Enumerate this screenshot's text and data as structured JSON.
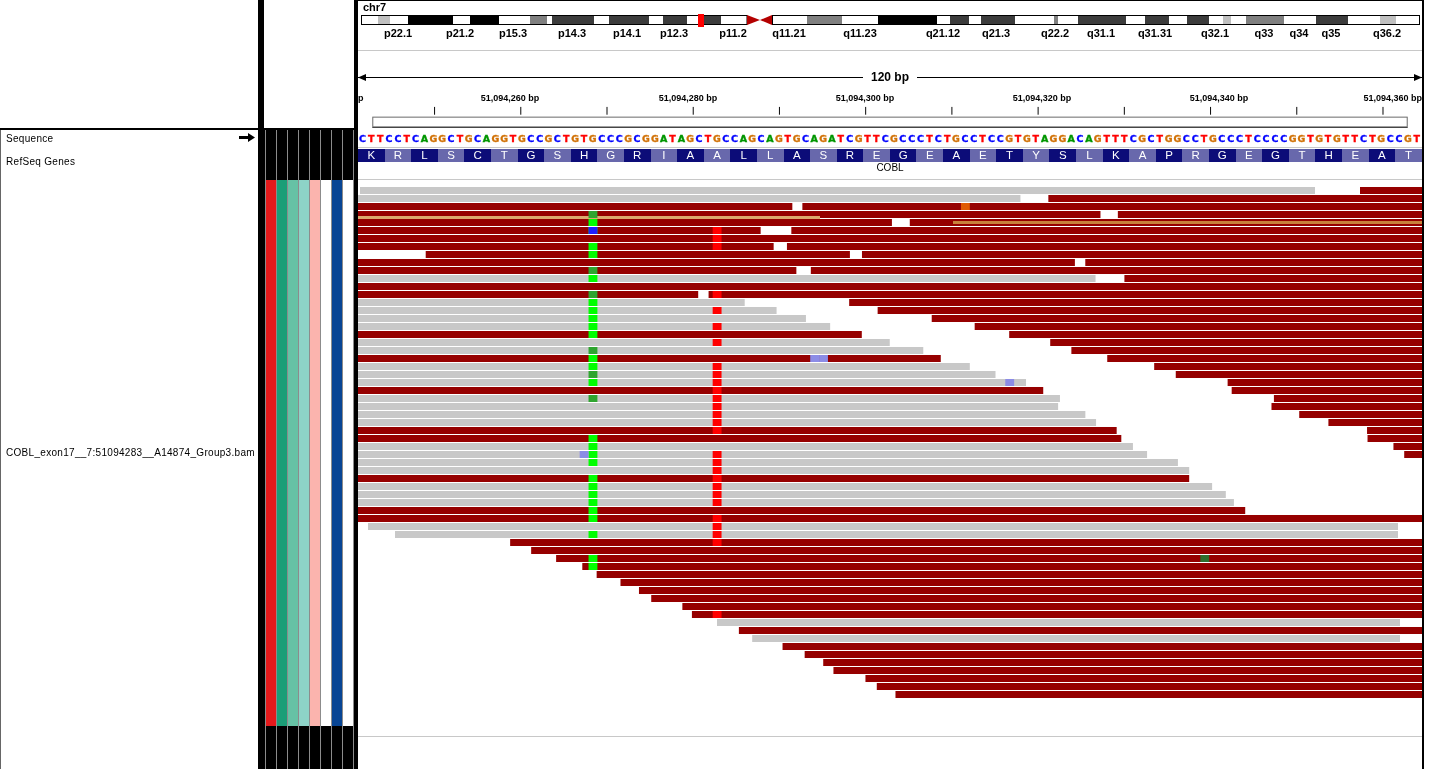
{
  "ideogram": {
    "chromosome": "chr7",
    "band_labels": [
      "p22.1",
      "p21.2",
      "p15.3",
      "p14.3",
      "p14.1",
      "p12.3",
      "p11.2",
      "q11.21",
      "q11.23",
      "q21.12",
      "q21.3",
      "q22.2",
      "q31.1",
      "q31.31",
      "q32.1",
      "q33",
      "q34",
      "q35",
      "q36.2"
    ]
  },
  "ruler": {
    "span": "120 bp",
    "tick_labels": [
      "p",
      "51,094,260 bp",
      "51,094,280 bp",
      "51,094,300 bp",
      "51,094,320 bp",
      "51,094,340 bp",
      "51,094,360 bp"
    ]
  },
  "tracks": [
    {
      "kind": "sequence",
      "name": "Sequence",
      "bases": [
        {
          "base": "C",
          "color": "#0000ff"
        },
        {
          "base": "T",
          "color": "#ff0000"
        },
        {
          "base": "T",
          "color": "#ff0000"
        },
        {
          "base": "C",
          "color": "#0000ff"
        },
        {
          "base": "C",
          "color": "#0000ff"
        },
        {
          "base": "T",
          "color": "#ff0000"
        },
        {
          "base": "C",
          "color": "#0000ff"
        },
        {
          "base": "A",
          "color": "#009600"
        },
        {
          "base": "G",
          "color": "#d17105"
        },
        {
          "base": "G",
          "color": "#d17105"
        },
        {
          "base": "C",
          "color": "#0000ff"
        },
        {
          "base": "T",
          "color": "#ff0000"
        },
        {
          "base": "G",
          "color": "#d17105"
        },
        {
          "base": "C",
          "color": "#0000ff"
        },
        {
          "base": "A",
          "color": "#009600"
        },
        {
          "base": "G",
          "color": "#d17105"
        },
        {
          "base": "G",
          "color": "#d17105"
        },
        {
          "base": "T",
          "color": "#ff0000"
        },
        {
          "base": "G",
          "color": "#d17105"
        },
        {
          "base": "C",
          "color": "#0000ff"
        },
        {
          "base": "C",
          "color": "#0000ff"
        },
        {
          "base": "G",
          "color": "#d17105"
        },
        {
          "base": "C",
          "color": "#0000ff"
        },
        {
          "base": "T",
          "color": "#ff0000"
        },
        {
          "base": "G",
          "color": "#d17105"
        },
        {
          "base": "T",
          "color": "#ff0000"
        },
        {
          "base": "G",
          "color": "#d17105"
        },
        {
          "base": "C",
          "color": "#0000ff"
        },
        {
          "base": "C",
          "color": "#0000ff"
        },
        {
          "base": "C",
          "color": "#0000ff"
        },
        {
          "base": "G",
          "color": "#d17105"
        },
        {
          "base": "C",
          "color": "#0000ff"
        },
        {
          "base": "G",
          "color": "#d17105"
        },
        {
          "base": "G",
          "color": "#d17105"
        },
        {
          "base": "A",
          "color": "#009600"
        },
        {
          "base": "T",
          "color": "#ff0000"
        },
        {
          "base": "A",
          "color": "#009600"
        },
        {
          "base": "G",
          "color": "#d17105"
        },
        {
          "base": "C",
          "color": "#0000ff"
        },
        {
          "base": "T",
          "color": "#ff0000"
        },
        {
          "base": "G",
          "color": "#d17105"
        },
        {
          "base": "C",
          "color": "#0000ff"
        },
        {
          "base": "C",
          "color": "#0000ff"
        },
        {
          "base": "A",
          "color": "#009600"
        },
        {
          "base": "G",
          "color": "#d17105"
        },
        {
          "base": "C",
          "color": "#0000ff"
        },
        {
          "base": "A",
          "color": "#009600"
        },
        {
          "base": "G",
          "color": "#d17105"
        },
        {
          "base": "T",
          "color": "#ff0000"
        },
        {
          "base": "G",
          "color": "#d17105"
        },
        {
          "base": "C",
          "color": "#0000ff"
        },
        {
          "base": "A",
          "color": "#009600"
        },
        {
          "base": "G",
          "color": "#d17105"
        },
        {
          "base": "A",
          "color": "#009600"
        },
        {
          "base": "T",
          "color": "#ff0000"
        },
        {
          "base": "C",
          "color": "#0000ff"
        },
        {
          "base": "G",
          "color": "#d17105"
        },
        {
          "base": "T",
          "color": "#ff0000"
        },
        {
          "base": "T",
          "color": "#ff0000"
        },
        {
          "base": "C",
          "color": "#0000ff"
        },
        {
          "base": "G",
          "color": "#d17105"
        },
        {
          "base": "C",
          "color": "#0000ff"
        },
        {
          "base": "C",
          "color": "#0000ff"
        },
        {
          "base": "C",
          "color": "#0000ff"
        },
        {
          "base": "T",
          "color": "#ff0000"
        },
        {
          "base": "C",
          "color": "#0000ff"
        },
        {
          "base": "T",
          "color": "#ff0000"
        },
        {
          "base": "G",
          "color": "#d17105"
        },
        {
          "base": "C",
          "color": "#0000ff"
        },
        {
          "base": "C",
          "color": "#0000ff"
        },
        {
          "base": "T",
          "color": "#ff0000"
        },
        {
          "base": "C",
          "color": "#0000ff"
        },
        {
          "base": "C",
          "color": "#0000ff"
        },
        {
          "base": "G",
          "color": "#d17105"
        },
        {
          "base": "T",
          "color": "#ff0000"
        },
        {
          "base": "G",
          "color": "#d17105"
        },
        {
          "base": "T",
          "color": "#ff0000"
        },
        {
          "base": "A",
          "color": "#009600"
        },
        {
          "base": "G",
          "color": "#d17105"
        },
        {
          "base": "G",
          "color": "#d17105"
        },
        {
          "base": "A",
          "color": "#009600"
        },
        {
          "base": "C",
          "color": "#0000ff"
        },
        {
          "base": "A",
          "color": "#009600"
        },
        {
          "base": "G",
          "color": "#d17105"
        },
        {
          "base": "T",
          "color": "#ff0000"
        },
        {
          "base": "T",
          "color": "#ff0000"
        },
        {
          "base": "T",
          "color": "#ff0000"
        },
        {
          "base": "C",
          "color": "#0000ff"
        },
        {
          "base": "G",
          "color": "#d17105"
        },
        {
          "base": "C",
          "color": "#0000ff"
        },
        {
          "base": "T",
          "color": "#ff0000"
        },
        {
          "base": "G",
          "color": "#d17105"
        },
        {
          "base": "G",
          "color": "#d17105"
        },
        {
          "base": "C",
          "color": "#0000ff"
        },
        {
          "base": "C",
          "color": "#0000ff"
        },
        {
          "base": "T",
          "color": "#ff0000"
        },
        {
          "base": "G",
          "color": "#d17105"
        },
        {
          "base": "C",
          "color": "#0000ff"
        },
        {
          "base": "C",
          "color": "#0000ff"
        },
        {
          "base": "C",
          "color": "#0000ff"
        },
        {
          "base": "T",
          "color": "#ff0000"
        },
        {
          "base": "C",
          "color": "#0000ff"
        },
        {
          "base": "C",
          "color": "#0000ff"
        },
        {
          "base": "C",
          "color": "#0000ff"
        },
        {
          "base": "C",
          "color": "#0000ff"
        },
        {
          "base": "G",
          "color": "#d17105"
        },
        {
          "base": "G",
          "color": "#d17105"
        },
        {
          "base": "T",
          "color": "#ff0000"
        },
        {
          "base": "G",
          "color": "#d17105"
        },
        {
          "base": "T",
          "color": "#ff0000"
        },
        {
          "base": "G",
          "color": "#d17105"
        },
        {
          "base": "T",
          "color": "#ff0000"
        },
        {
          "base": "T",
          "color": "#ff0000"
        },
        {
          "base": "C",
          "color": "#0000ff"
        },
        {
          "base": "T",
          "color": "#ff0000"
        },
        {
          "base": "G",
          "color": "#d17105"
        },
        {
          "base": "C",
          "color": "#0000ff"
        },
        {
          "base": "C",
          "color": "#0000ff"
        },
        {
          "base": "G",
          "color": "#d17105"
        },
        {
          "base": "T",
          "color": "#ff0000"
        }
      ]
    },
    {
      "kind": "gene",
      "name": "RefSeq Genes",
      "gene": "COBL",
      "amino_acids": [
        "K",
        "R",
        "L",
        "S",
        "C",
        "T",
        "G",
        "S",
        "H",
        "G",
        "R",
        "I",
        "A",
        "A",
        "L",
        "L",
        "A",
        "S",
        "R",
        "E",
        "G",
        "E",
        "A",
        "E",
        "T",
        "Y",
        "S",
        "L",
        "K",
        "A",
        "P",
        "R",
        "G",
        "E",
        "G",
        "T",
        "H",
        "E",
        "A",
        "T"
      ]
    },
    {
      "kind": "alignment",
      "name": "COBL_exon17__7:51094283__A14874_Group3.bam",
      "attributes": [
        {
          "color": "#e41a1c"
        },
        {
          "color": "#1b9e77"
        },
        {
          "color": "#66c2a5"
        },
        {
          "color": "#8dd3c7"
        },
        {
          "color": "#fbb4ae"
        },
        {
          "color": "#ffffff"
        },
        {
          "color": "#084594"
        },
        {
          "color": "#ffffff"
        }
      ]
    }
  ]
}
